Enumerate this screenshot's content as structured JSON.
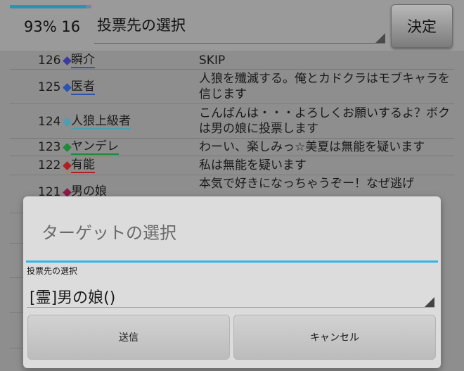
{
  "header": {
    "progress_percent": 93,
    "status_text": "93% 16",
    "vote_select_label": "投票先の選択",
    "decide_button": "決定"
  },
  "log": [
    {
      "num": "126",
      "diamond_color": "#3b3ba0",
      "name": "瞬介",
      "underline_color": "#4a4ab0",
      "message": "SKIP"
    },
    {
      "num": "125",
      "diamond_color": "#2b54b0",
      "name": "医者",
      "underline_color": "#2b54b0",
      "message": "人狼を殲滅する。俺とカドクラはモブキャラを信じます"
    },
    {
      "num": "124",
      "diamond_color": "#4aa0b0",
      "name": "人狼上級者",
      "underline_color": "#4aa0b0",
      "message": "こんばんは・・・よろしくお願いするよ？ボクは男の娘に投票します"
    },
    {
      "num": "123",
      "diamond_color": "#1e8a3a",
      "name": "ヤンデレ",
      "underline_color": "#1e8a3a",
      "message": "わーい、楽しみっ☆美夏は無能を疑います"
    },
    {
      "num": "122",
      "diamond_color": "#b02020",
      "name": "有能",
      "underline_color": "#b02020",
      "message": "私は無能を疑います"
    },
    {
      "num": "121",
      "diamond_color": "#8a1a4a",
      "name": "男の娘",
      "underline_color": "#8a1a4a",
      "message": "本気で好きになっちゃうぞー！なぜ逃げ"
    }
  ],
  "dialog": {
    "title": "ターゲットの選択",
    "field_label": "投票先の選択",
    "selected_value": "[霊]男の娘()",
    "send_button": "送信",
    "cancel_button": "キャンセル",
    "accent_color": "#33b5e5"
  }
}
